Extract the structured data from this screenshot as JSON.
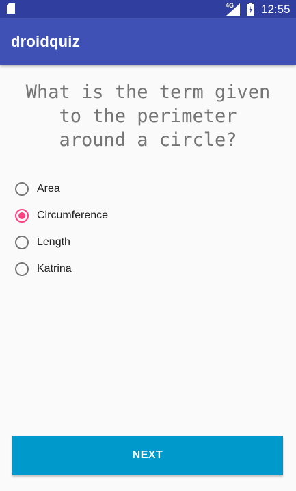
{
  "status_bar": {
    "network": "4G",
    "time": "12:55",
    "icons": [
      "sd-card-icon",
      "signal-icon",
      "battery-icon"
    ]
  },
  "app_bar": {
    "title": "droidquiz"
  },
  "quiz": {
    "question_lines": [
      "What is the term given",
      "to the perimeter",
      "around a circle?"
    ],
    "options": [
      {
        "label": "Area",
        "checked": false
      },
      {
        "label": "Circumference",
        "checked": true
      },
      {
        "label": "Length",
        "checked": false
      },
      {
        "label": "Katrina",
        "checked": false
      }
    ],
    "next_label": "NEXT"
  },
  "colors": {
    "status_bar": "#303f9f",
    "app_bar": "#3f51b5",
    "accent": "#ff4081",
    "button": "#0099cc",
    "question_text": "#757575"
  }
}
